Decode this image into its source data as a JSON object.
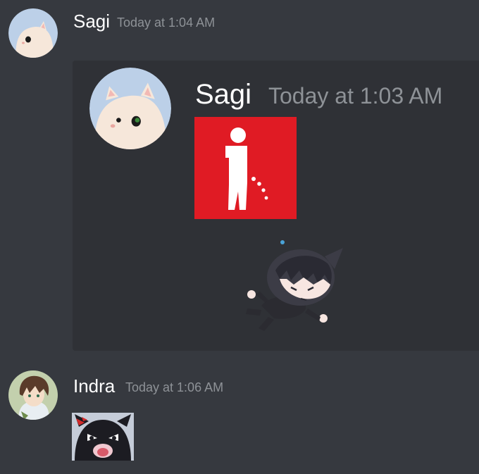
{
  "messages": [
    {
      "username": "Sagi",
      "timestamp": "Today at 1:04 AM",
      "avatar_icon": "white-cat-avatar-icon",
      "embed": {
        "username": "Sagi",
        "timestamp": "Today at 1:03 AM",
        "avatar_icon": "white-cat-avatar-icon",
        "image_icon": "red-no-peeing-sign-icon",
        "sticker_icon": "chibi-boy-sticker-icon"
      }
    },
    {
      "username": "Indra",
      "timestamp": "Today at 1:06 AM",
      "avatar_icon": "anime-boy-avatar-icon",
      "sticker_icon": "angry-black-cat-sticker-icon"
    }
  ],
  "colors": {
    "background": "#36393f",
    "embed_background": "#2f3136",
    "username": "#ffffff",
    "timestamp": "#8e9297",
    "sign_red": "#e01b24"
  }
}
